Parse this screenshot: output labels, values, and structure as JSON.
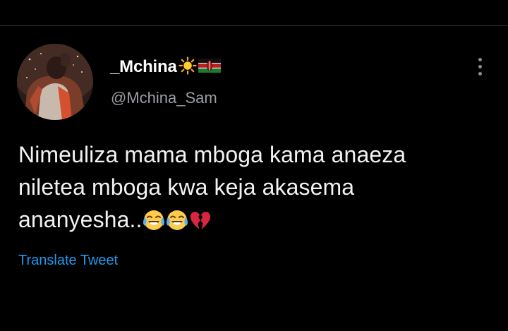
{
  "tweet": {
    "author": {
      "display_name": "_Mchina",
      "handle": "@Mchina_Sam",
      "name_icons": [
        "sun-icon",
        "kenya-flag-icon"
      ]
    },
    "text_lines": [
      "Nimeuliza mama mboga kama anaeza",
      "niletea mboga kwa keja akasema",
      "ananyesha.."
    ],
    "text_emojis": [
      "tears-of-joy-emoji",
      "tears-of-joy-emoji",
      "broken-heart-emoji"
    ],
    "translate_label": "Translate Tweet",
    "more_icon": "more-vertical-icon"
  },
  "colors": {
    "background": "#000000",
    "text": "#f2f2f2",
    "secondary_text": "#9a9ea3",
    "link": "#1d9bf0",
    "divider": "#2f3336"
  }
}
